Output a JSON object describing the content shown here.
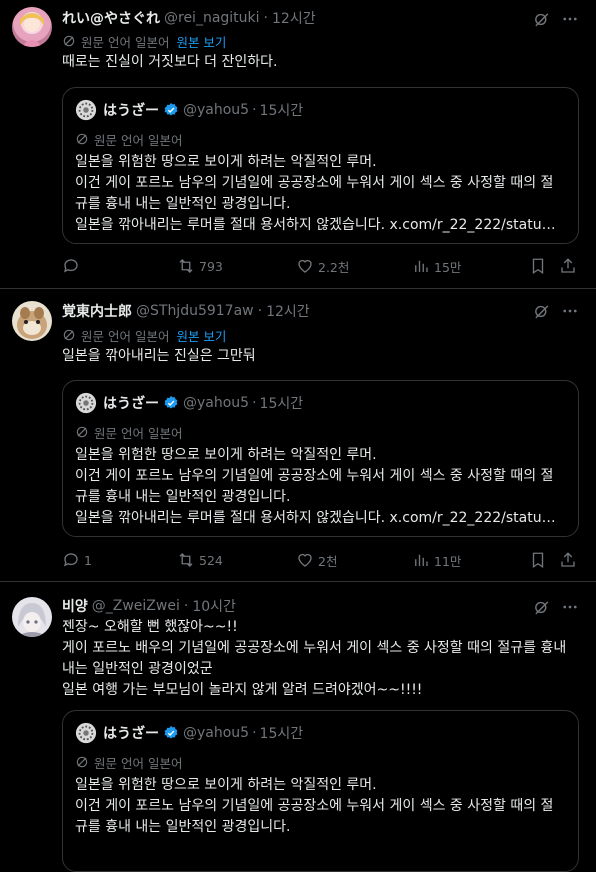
{
  "colors": {
    "background": "#000000",
    "text": "#e7e9ea",
    "muted": "#71767b",
    "link": "#1d9bf0",
    "border": "#2f3336",
    "verified": "#1d9bf0"
  },
  "posts": [
    {
      "display_name": "れい@やさぐれ",
      "handle": "@rei_nagituki",
      "time": "12시간",
      "translation_label": "원문 언어 일본어",
      "show_original": "원본 보기",
      "text": "때로는 진실이 거짓보다 더 잔인하다.",
      "quote": {
        "display_name": "はうざー",
        "handle": "@yahou5",
        "time": "15시간",
        "translation_label": "원문 언어 일본어",
        "text": "일본을 위험한 땅으로 보이게 하려는 악질적인 루머.\n이건 게이 포르노 남우의 기념일에 공공장소에 누워서 게이 섹스 중 사정할 때의 절규를 흉내 내는 일반적인 광경입니다.\n일본을 깎아내리는 루머를 절대 용서하지 않겠습니다. x.com/r_22_222/statu…"
      },
      "stats": {
        "replies": "",
        "reposts": "793",
        "likes": "2.2천",
        "views": "15만"
      }
    },
    {
      "display_name": "覚東内士郎",
      "handle": "@SThjdu5917aw",
      "time": "12시간",
      "translation_label": "원문 언어 일본어",
      "show_original": "원본 보기",
      "text": "일본을 깎아내리는 진실은 그만둬",
      "quote": {
        "display_name": "はうざー",
        "handle": "@yahou5",
        "time": "15시간",
        "translation_label": "원문 언어 일본어",
        "text": "일본을 위험한 땅으로 보이게 하려는 악질적인 루머.\n이건 게이 포르노 남우의 기념일에 공공장소에 누워서 게이 섹스 중 사정할 때의 절규를 흉내 내는 일반적인 광경입니다.\n일본을 깎아내리는 루머를 절대 용서하지 않겠습니다. x.com/r_22_222/statu…"
      },
      "stats": {
        "replies": "1",
        "reposts": "524",
        "likes": "2천",
        "views": "11만"
      }
    },
    {
      "display_name": "비양",
      "handle": "@_ZweiZwei",
      "time": "10시간",
      "text": "젠장~ 오해할 뻔 했잖아~~!!\n게이 포르노 배우의 기념일에 공공장소에 누워서 게이 섹스 중 사정할 때의 절규를 흉내 내는 일반적인 광경이었군\n일본 여행 가는 부모님이 놀라지 않게 알려 드려야겠어~~!!!!",
      "quote": {
        "display_name": "はうざー",
        "handle": "@yahou5",
        "time": "15시간",
        "translation_label": "원문 언어 일본어",
        "text": "일본을 위험한 땅으로 보이게 하려는 악질적인 루머.\n이건 게이 포르노 남우의 기념일에 공공장소에 누워서 게이 섹스 중 사정할 때의 절규를 흉내 내는 일반적인 광경입니다."
      }
    }
  ],
  "icons": [
    "grok-icon",
    "more-icon",
    "translate-icon",
    "verified-badge-icon",
    "reply-icon",
    "repost-icon",
    "like-icon",
    "views-icon",
    "bookmark-icon",
    "share-icon"
  ]
}
